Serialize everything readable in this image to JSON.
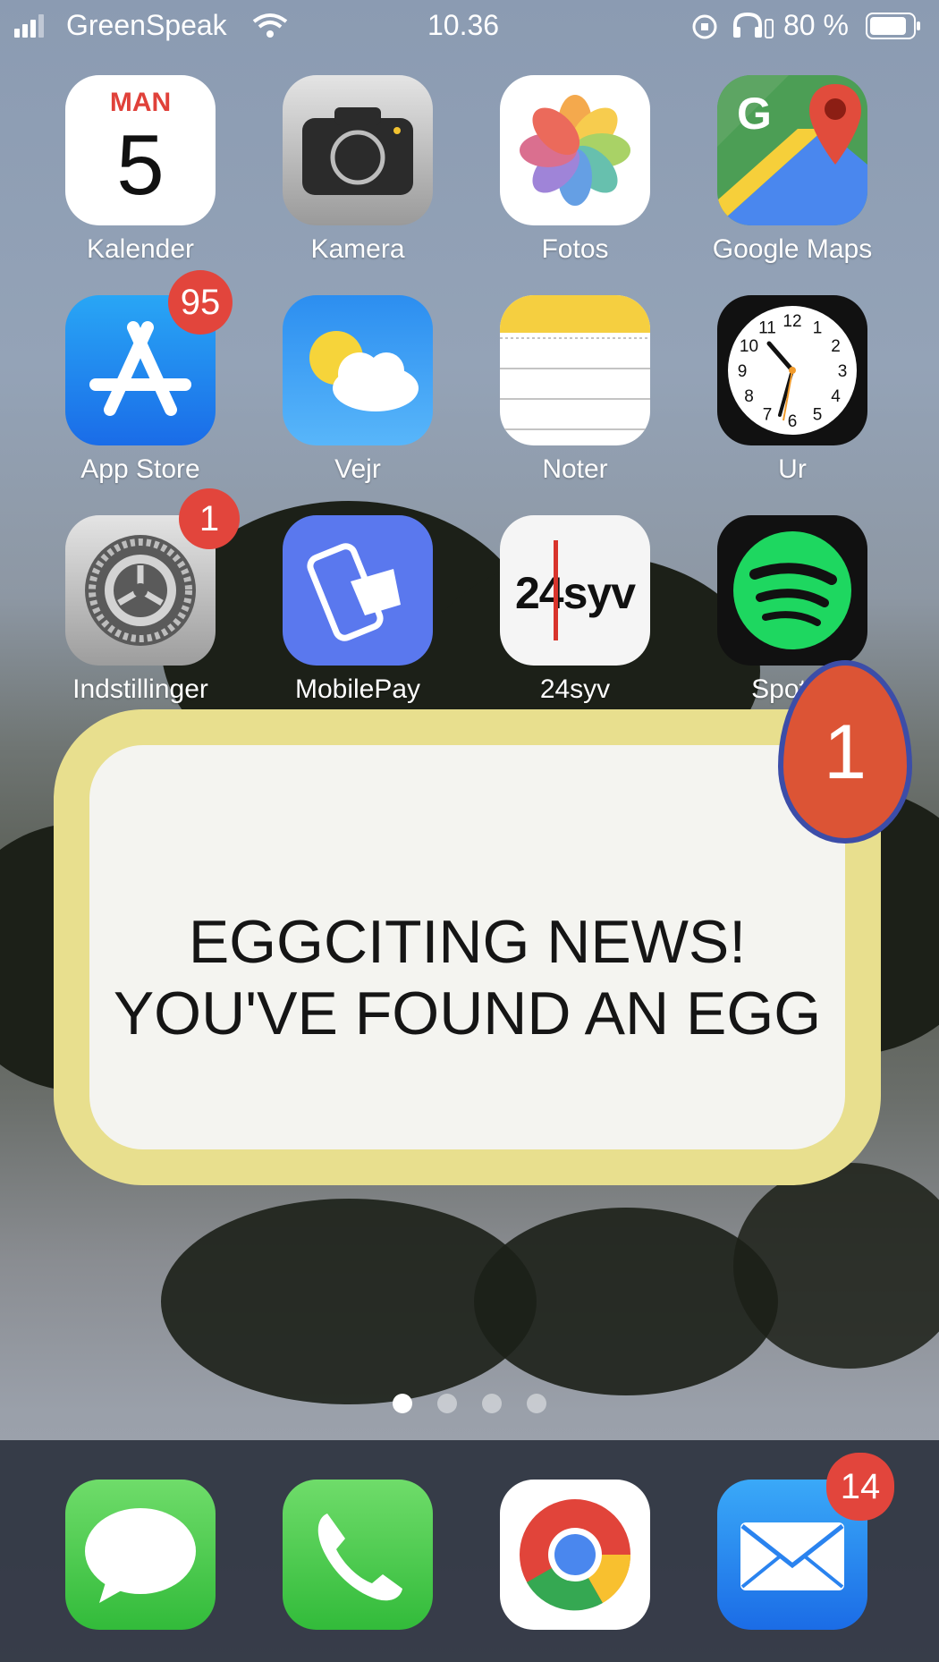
{
  "status_bar": {
    "carrier": "GreenSpeak",
    "time": "10.36",
    "battery": "80 %"
  },
  "apps": [
    {
      "id": "kalender",
      "label": "Kalender",
      "day": "MAN",
      "date": "5"
    },
    {
      "id": "kamera",
      "label": "Kamera"
    },
    {
      "id": "fotos",
      "label": "Fotos"
    },
    {
      "id": "google-maps",
      "label": "Google Maps",
      "glyph": "G"
    },
    {
      "id": "app-store",
      "label": "App Store",
      "badge": "95"
    },
    {
      "id": "vejr",
      "label": "Vejr"
    },
    {
      "id": "noter",
      "label": "Noter"
    },
    {
      "id": "ur",
      "label": "Ur",
      "numerals": [
        "12",
        "1",
        "2",
        "3",
        "4",
        "5",
        "6",
        "7",
        "8",
        "9",
        "10",
        "11"
      ]
    },
    {
      "id": "indstillinger",
      "label": "Indstillinger",
      "badge": "1"
    },
    {
      "id": "mobilepay",
      "label": "MobilePay"
    },
    {
      "id": "24syv",
      "label": "24syv",
      "logo": "24syv"
    },
    {
      "id": "spotify",
      "label": "Spotify"
    }
  ],
  "popup": {
    "line1": "EGGCITING NEWS!",
    "line2": "YOU'VE FOUND AN EGG",
    "egg_count": "1"
  },
  "dock": [
    {
      "id": "messages",
      "icon": "messages-icon"
    },
    {
      "id": "phone",
      "icon": "phone-icon"
    },
    {
      "id": "chrome",
      "icon": "chrome-icon"
    },
    {
      "id": "mail",
      "icon": "mail-icon",
      "badge": "14"
    }
  ],
  "colors": {
    "popup_frame": "#e8df8e",
    "popup_fill": "#f4f4f0",
    "badge": "#e2453c",
    "egg": "#dc5435",
    "egg_outline": "#3c4da8"
  }
}
